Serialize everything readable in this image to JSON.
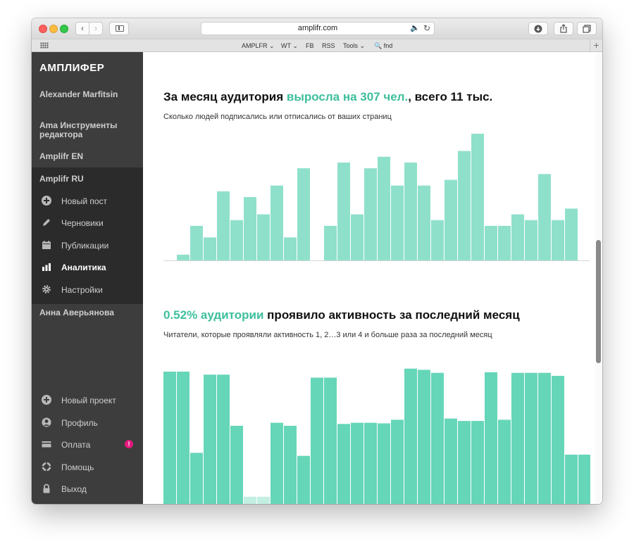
{
  "browser": {
    "url": "amplifr.com",
    "back": "‹",
    "forward": "›",
    "bookmarks": [
      "AMPLFR",
      "WT",
      "FB",
      "RSS",
      "Tools",
      "fnd"
    ],
    "bookmark_chevron": "⌄"
  },
  "sidebar": {
    "logo": "АМПЛИФЕР",
    "accounts": [
      "Alexander Marfitsin",
      "Ama Инструменты редактора",
      "Amplifr EN",
      "Amplifr RU"
    ],
    "menu": [
      {
        "label": "Новый пост",
        "icon": "plus-circle-icon"
      },
      {
        "label": "Черновики",
        "icon": "pencil-icon"
      },
      {
        "label": "Публикации",
        "icon": "calendar-icon"
      },
      {
        "label": "Аналитика",
        "icon": "bar-chart-icon",
        "active": true
      },
      {
        "label": "Настройки",
        "icon": "gear-icon"
      }
    ],
    "other_account": "Анна Аверьянова",
    "bottom_menu": [
      {
        "label": "Новый проект",
        "icon": "plus-circle-icon"
      },
      {
        "label": "Профиль",
        "icon": "user-icon"
      },
      {
        "label": "Оплата",
        "icon": "credit-card-icon",
        "badge": "!"
      },
      {
        "label": "Помощь",
        "icon": "lifebuoy-icon"
      },
      {
        "label": "Выход",
        "icon": "lock-icon"
      }
    ]
  },
  "section1": {
    "title_pre": "За месяц аудитория ",
    "title_highlight": "выросла на 307 чел.",
    "title_post": ", всего 11 тыс.",
    "subtitle": "Сколько людей подписались или отписались от ваших страниц"
  },
  "section2": {
    "title_highlight": "0.52% аудитории",
    "title_post": " проявило активность за последний месяц",
    "subtitle": "Читатели, которые проявляли активность 1, 2…3 или 4 и больше раза за последний месяц"
  },
  "colors": {
    "chart1_bar": "#8fe0cb",
    "chart2_bar": "#66d6b8",
    "chart2_bar_light": "#c3eee2",
    "accent": "#3dbf9c",
    "sidebar_bg": "#3d3d3d"
  },
  "chart_data": [
    {
      "type": "bar",
      "title": "",
      "ylim": [
        0,
        22
      ],
      "values": [
        0,
        1,
        6,
        4,
        12,
        7,
        11,
        8,
        13,
        4,
        16,
        null,
        6,
        17,
        8,
        16,
        18,
        13,
        17,
        13,
        7,
        14,
        19,
        22,
        6,
        6,
        8,
        7,
        15,
        7,
        9
      ]
    },
    {
      "type": "bar",
      "title": "",
      "ylim": [
        0,
        22
      ],
      "values": [
        22,
        22,
        8.5,
        21.5,
        21.5,
        13,
        0,
        0,
        13.5,
        13,
        8,
        21,
        21,
        13.3,
        13.5,
        13.5,
        13.4,
        14,
        22.5,
        22.3,
        21.8,
        14.2,
        13.8,
        13.8,
        21.9,
        14,
        21.8,
        21.8,
        21.8,
        21.3,
        8.2,
        8.2
      ],
      "light_indices": [
        6,
        7
      ],
      "light_values": [
        1.2,
        1.2
      ]
    }
  ]
}
